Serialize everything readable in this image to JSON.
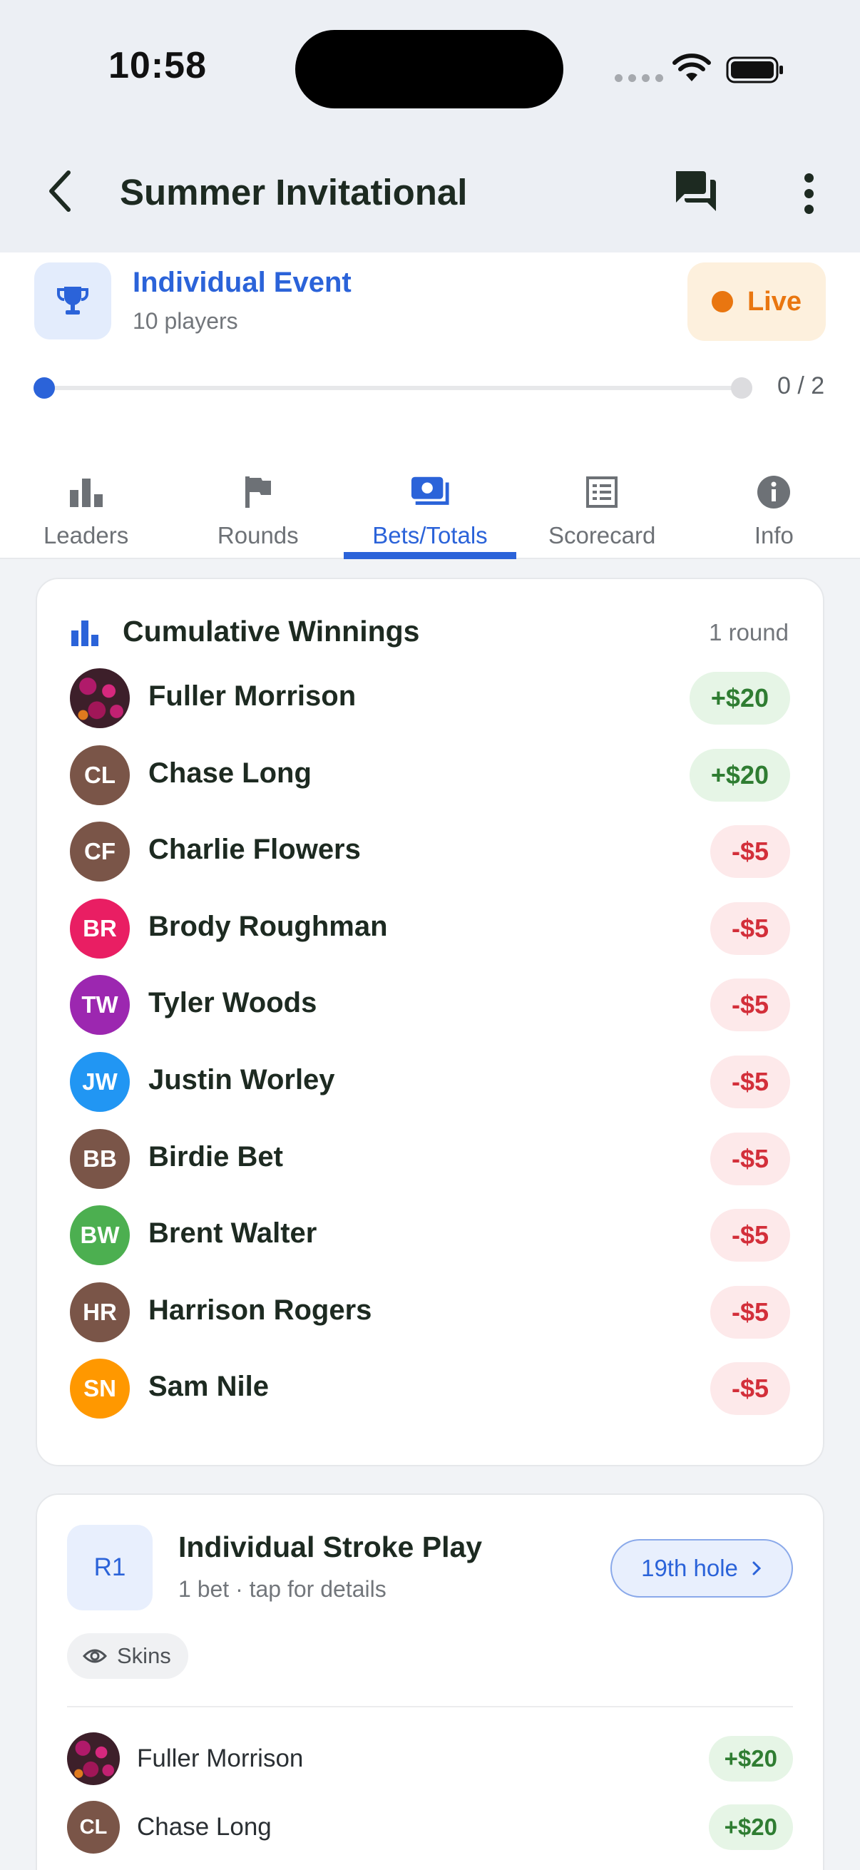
{
  "status_bar": {
    "time": "10:58"
  },
  "header": {
    "title": "Summer Invitational"
  },
  "event": {
    "type": "Individual Event",
    "subtitle": "10 players",
    "status": "Live",
    "progress_text": "0 / 2",
    "progress": 0
  },
  "tabs": [
    {
      "label": "Leaders",
      "icon": "bar-chart-icon"
    },
    {
      "label": "Rounds",
      "icon": "flag-icon"
    },
    {
      "label": "Bets/Totals",
      "icon": "money-icon",
      "active": true
    },
    {
      "label": "Scorecard",
      "icon": "scorecard-icon"
    },
    {
      "label": "Info",
      "icon": "info-icon"
    }
  ],
  "cumulative": {
    "title": "Cumulative Winnings",
    "rounds": "1 round",
    "players": [
      {
        "initials": "",
        "name": "Fuller Morrison",
        "amount": "+$20",
        "positive": true,
        "photo": true,
        "color": ""
      },
      {
        "initials": "CL",
        "name": "Chase Long",
        "amount": "+$20",
        "positive": true,
        "color": "#7a5548"
      },
      {
        "initials": "CF",
        "name": "Charlie Flowers",
        "amount": "-$5",
        "positive": false,
        "color": "#7a5548"
      },
      {
        "initials": "BR",
        "name": "Brody Roughman",
        "amount": "-$5",
        "positive": false,
        "color": "#e91e63"
      },
      {
        "initials": "TW",
        "name": "Tyler Woods",
        "amount": "-$5",
        "positive": false,
        "color": "#9c27b0"
      },
      {
        "initials": "JW",
        "name": "Justin Worley",
        "amount": "-$5",
        "positive": false,
        "color": "#2196f3"
      },
      {
        "initials": "BB",
        "name": "Birdie Bet",
        "amount": "-$5",
        "positive": false,
        "color": "#7a5548"
      },
      {
        "initials": "BW",
        "name": "Brent Walter",
        "amount": "-$5",
        "positive": false,
        "color": "#4caf50"
      },
      {
        "initials": "HR",
        "name": "Harrison Rogers",
        "amount": "-$5",
        "positive": false,
        "color": "#7a5548"
      },
      {
        "initials": "SN",
        "name": "Sam Nile",
        "amount": "-$5",
        "positive": false,
        "color": "#ff9800"
      }
    ]
  },
  "round": {
    "badge": "R1",
    "title": "Individual Stroke Play",
    "subtitle": "1 bet · tap for details",
    "hole_button": "19th hole",
    "chip": "Skins",
    "players": [
      {
        "initials": "",
        "name": "Fuller Morrison",
        "amount": "+$20",
        "photo": true,
        "color": ""
      },
      {
        "initials": "CL",
        "name": "Chase Long",
        "amount": "+$20",
        "color": "#7a5548"
      }
    ]
  },
  "colors": {
    "accent": "#2b63d9",
    "live": "#e97610",
    "positive": "#2f7d32",
    "negative": "#d32f3a"
  }
}
